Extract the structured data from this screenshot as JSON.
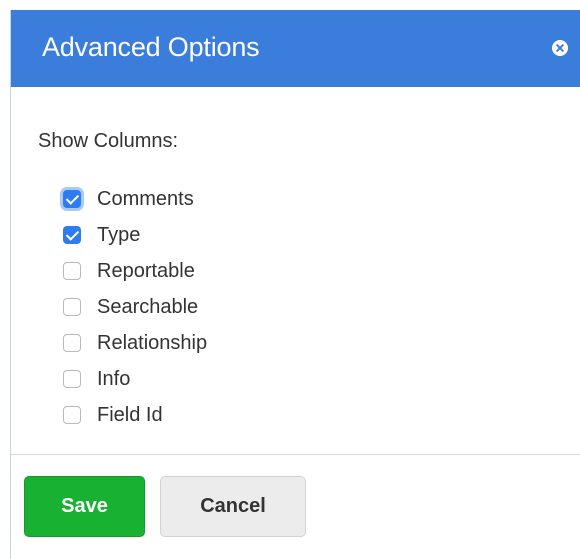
{
  "dialog": {
    "title": "Advanced Options",
    "close_icon": "close-icon",
    "header_color": "#3b7ddb"
  },
  "columns": {
    "label": "Show Columns:",
    "items": [
      {
        "label": "Comments",
        "checked": true
      },
      {
        "label": "Type",
        "checked": true
      },
      {
        "label": "Reportable",
        "checked": false
      },
      {
        "label": "Searchable",
        "checked": false
      },
      {
        "label": "Relationship",
        "checked": false
      },
      {
        "label": "Info",
        "checked": false
      },
      {
        "label": "Field Id",
        "checked": false
      }
    ]
  },
  "footer": {
    "save_label": "Save",
    "cancel_label": "Cancel",
    "save_color": "#18b132"
  }
}
